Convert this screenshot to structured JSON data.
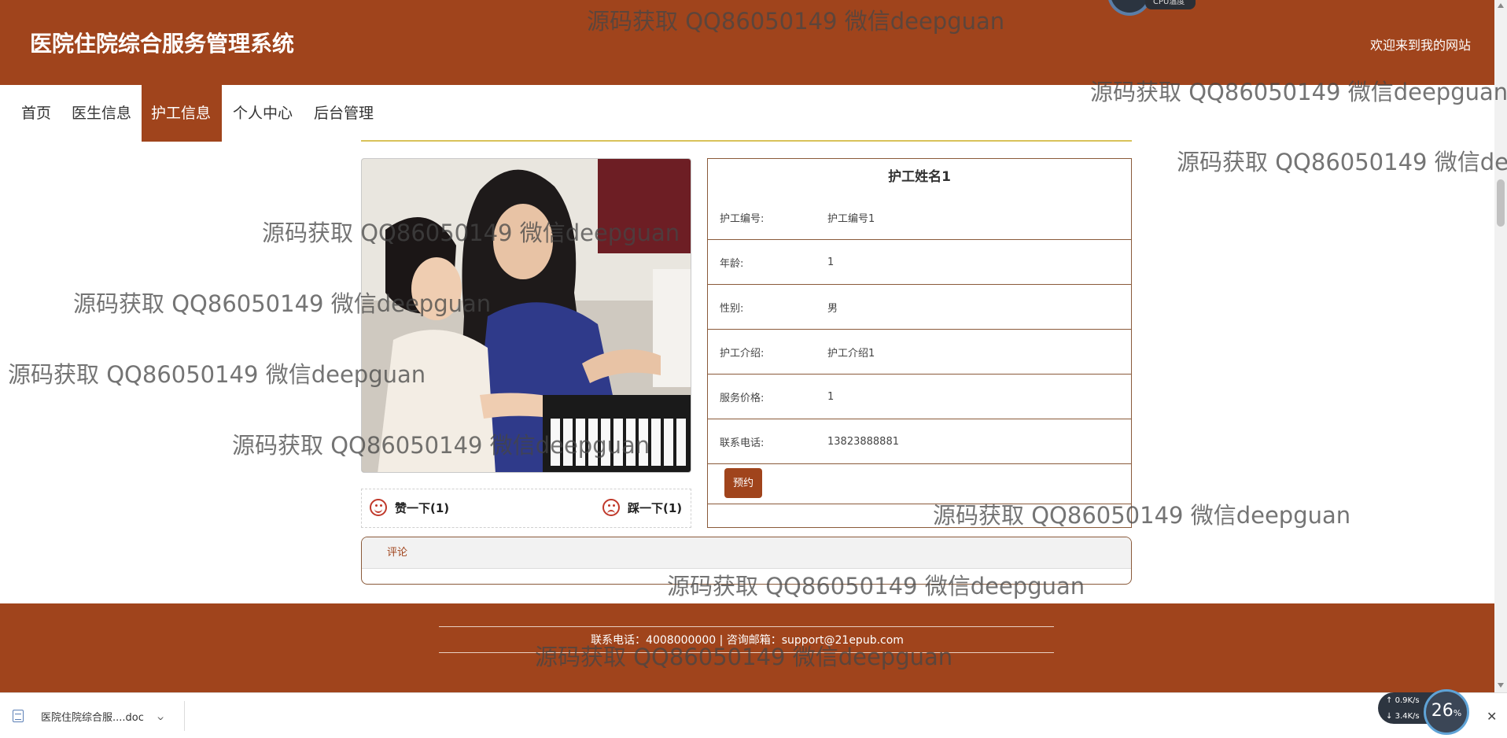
{
  "header": {
    "site_title": "医院住院综合服务管理系统",
    "welcome": "欢迎来到我的网站",
    "cpu_label": "CPU温度"
  },
  "nav": {
    "items": [
      {
        "label": "首页"
      },
      {
        "label": "医生信息"
      },
      {
        "label": "护工信息",
        "active": true
      },
      {
        "label": "个人中心"
      },
      {
        "label": "后台管理"
      }
    ]
  },
  "votes": {
    "like": "赞一下(1)",
    "dislike": "踩一下(1)"
  },
  "detail": {
    "title": "护工姓名1",
    "rows": [
      {
        "label": "护工编号:",
        "value": "护工编号1"
      },
      {
        "label": "年龄:",
        "value": "1"
      },
      {
        "label": "性别:",
        "value": "男"
      },
      {
        "label": "护工介绍:",
        "value": "护工介绍1"
      },
      {
        "label": "服务价格:",
        "value": "1"
      },
      {
        "label": "联系电话:",
        "value": "13823888881"
      }
    ],
    "book_button": "预约"
  },
  "comments": {
    "label": "评论"
  },
  "footer": {
    "contact": "联系电话：4008000000 | 咨询邮箱：support@21epub.com"
  },
  "download_bar": {
    "file_name": "医院住院综合服....doc",
    "chevron": "^",
    "close": "✕"
  },
  "net_widget": {
    "up": "0.9",
    "up_unit": "K/s",
    "down": "3.4",
    "down_unit": "K/s",
    "percent": "26",
    "percent_unit": "%"
  },
  "watermark": "源码获取 QQ86050149 微信deepguan",
  "colors": {
    "brand": "#a0441c",
    "divider": "#d9c25a",
    "border": "#8a5a3a"
  }
}
